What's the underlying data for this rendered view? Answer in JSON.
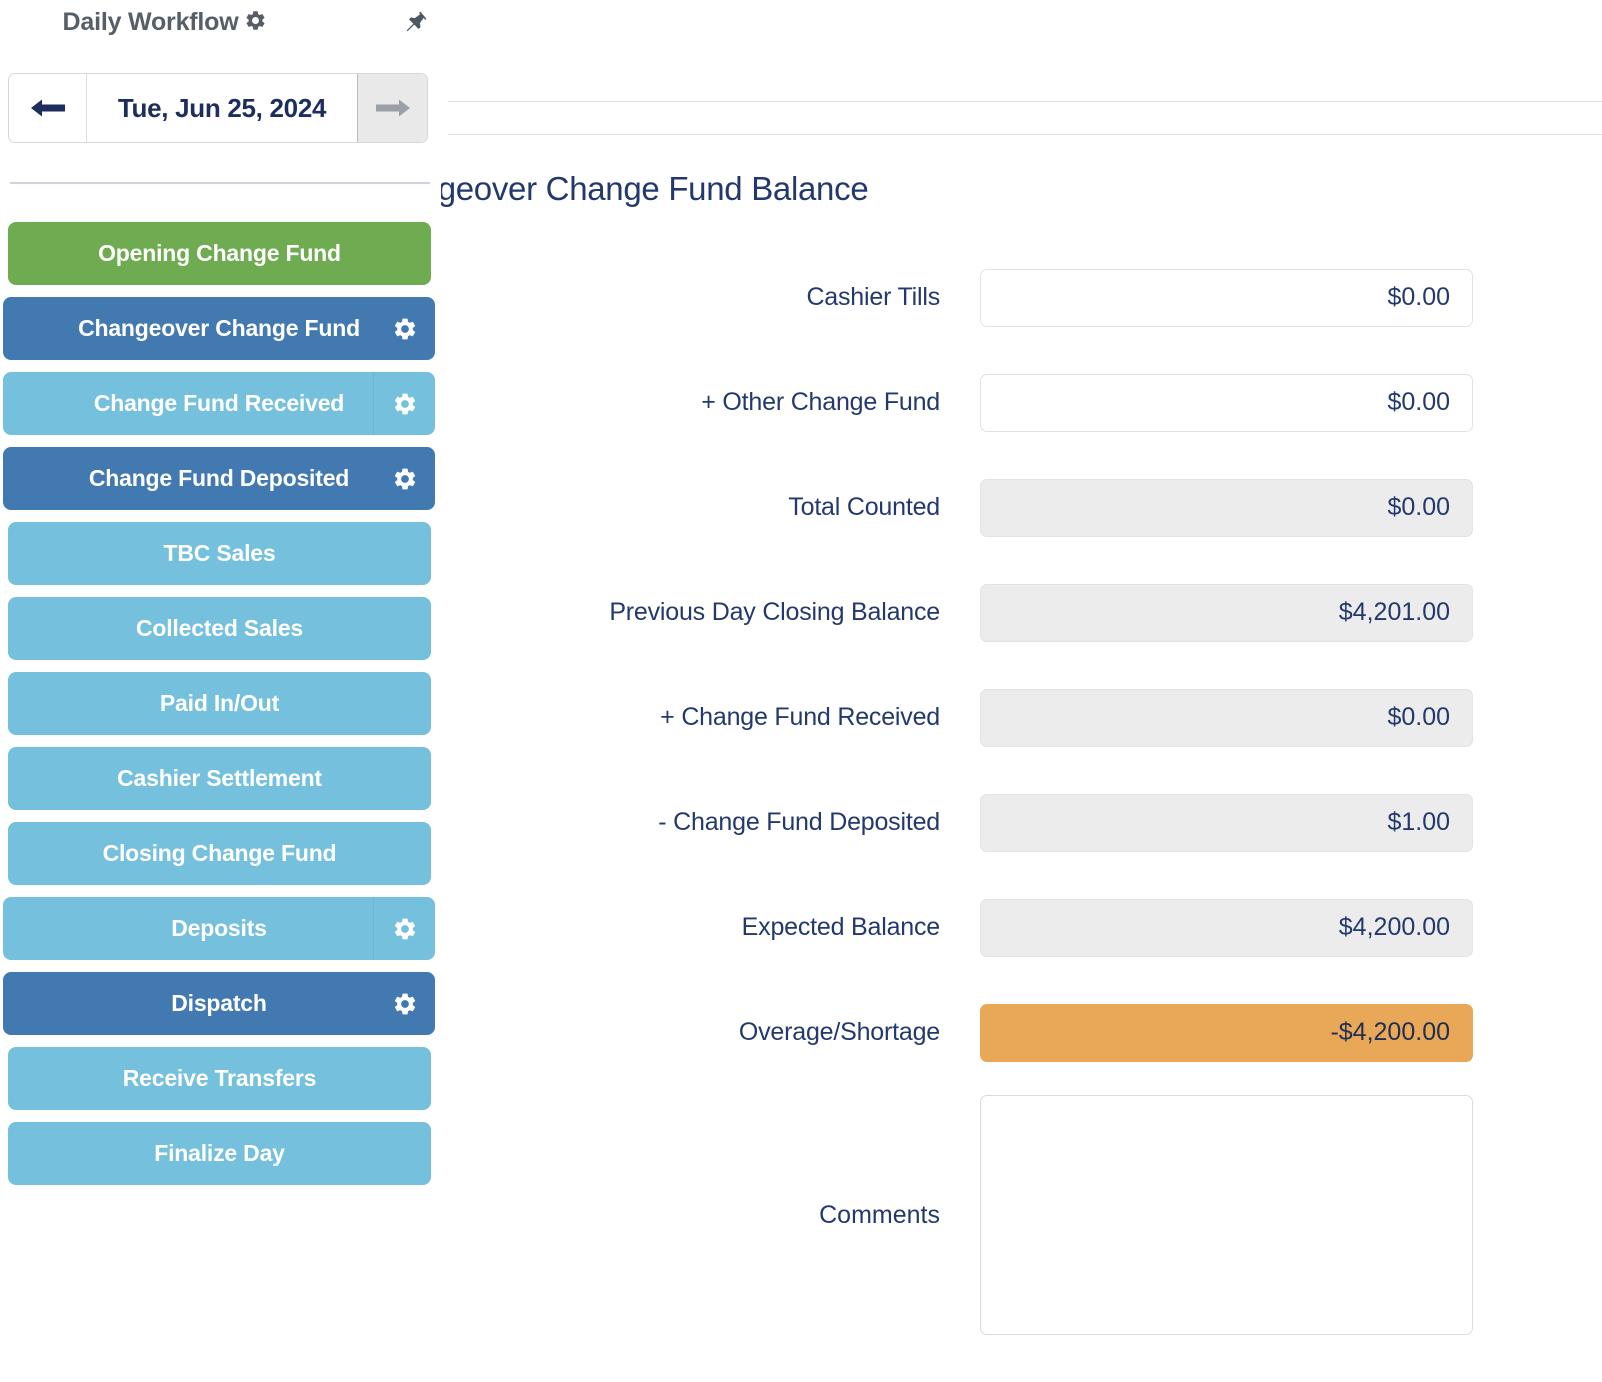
{
  "panel": {
    "title": "Daily Workflow",
    "title_gear_icon": "gear-icon",
    "pin_icon": "pushpin-icon",
    "date_nav": {
      "prev_icon": "arrow-left-icon",
      "current_date": "Tue, Jun 25, 2024",
      "next_icon": "arrow-right-icon"
    },
    "steps": [
      {
        "label": "Opening Change Fund",
        "style": "green",
        "gear": false
      },
      {
        "label": "Changeover Change Fund",
        "style": "dark",
        "gear": true
      },
      {
        "label": "Change Fund Received",
        "style": "light",
        "gear": true
      },
      {
        "label": "Change Fund Deposited",
        "style": "dark",
        "gear": true
      },
      {
        "label": "TBC Sales",
        "style": "light",
        "gear": false
      },
      {
        "label": "Collected Sales",
        "style": "light",
        "gear": false
      },
      {
        "label": "Paid In/Out",
        "style": "light",
        "gear": false
      },
      {
        "label": "Cashier Settlement",
        "style": "light",
        "gear": false
      },
      {
        "label": "Closing Change Fund",
        "style": "light",
        "gear": false
      },
      {
        "label": "Deposits",
        "style": "light",
        "gear": true
      },
      {
        "label": "Dispatch",
        "style": "dark",
        "gear": true
      },
      {
        "label": "Receive Transfers",
        "style": "light",
        "gear": false
      },
      {
        "label": "Finalize Day",
        "style": "light",
        "gear": false
      }
    ]
  },
  "main": {
    "title": "Changeover Change Fund Balance",
    "fields": [
      {
        "label": "Cashier Tills",
        "value": "$0.00",
        "readonly": false,
        "alert": false
      },
      {
        "label": "+ Other Change Fund",
        "value": "$0.00",
        "readonly": false,
        "alert": false
      },
      {
        "label": "Total Counted",
        "value": "$0.00",
        "readonly": true,
        "alert": false
      },
      {
        "label": "Previous Day Closing Balance",
        "value": "$4,201.00",
        "readonly": true,
        "alert": false
      },
      {
        "label": "+ Change Fund Received",
        "value": "$0.00",
        "readonly": true,
        "alert": false
      },
      {
        "label": "- Change Fund Deposited",
        "value": "$1.00",
        "readonly": true,
        "alert": false
      },
      {
        "label": "Expected Balance",
        "value": "$4,200.00",
        "readonly": true,
        "alert": false
      },
      {
        "label": "Overage/Shortage",
        "value": "-$4,200.00",
        "readonly": true,
        "alert": true
      }
    ],
    "comments": {
      "label": "Comments",
      "value": "",
      "placeholder": ""
    }
  },
  "colors": {
    "green": "#6fac51",
    "dark_blue": "#4279b0",
    "light_blue": "#74c0dd",
    "alert_orange": "#e8a857",
    "navy_text": "#23396d",
    "panel_title_grey": "#565f68"
  }
}
